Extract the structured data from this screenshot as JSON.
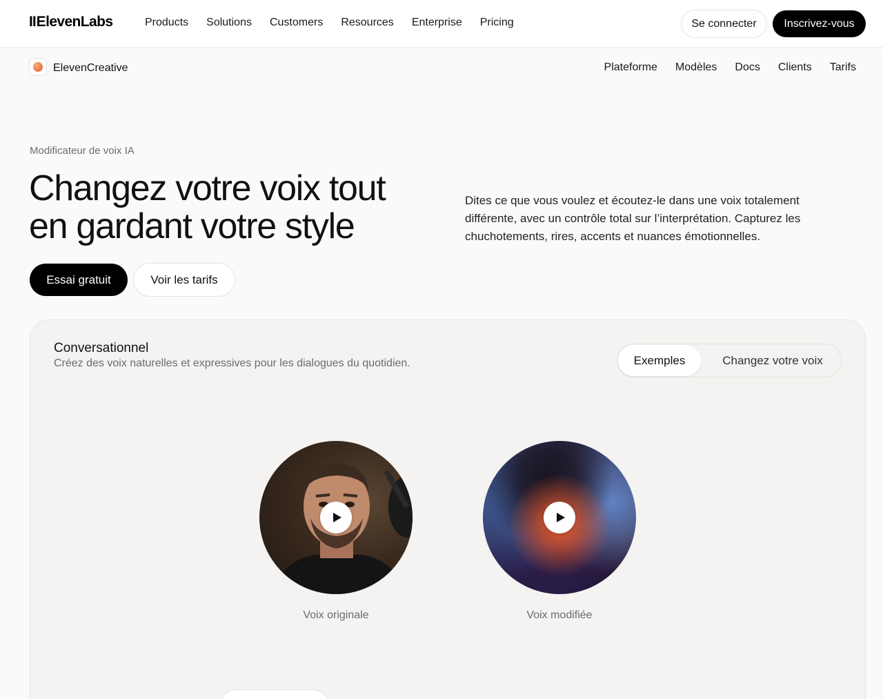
{
  "topnav": {
    "brand_bars": "II",
    "brand_name": "ElevenLabs",
    "menu": [
      "Products",
      "Solutions",
      "Customers",
      "Resources",
      "Enterprise",
      "Pricing"
    ],
    "login_label": "Se connecter",
    "signup_label": "Inscrivez-vous"
  },
  "subnav": {
    "product_name": "ElevenCreative",
    "menu": [
      "Plateforme",
      "Modèles",
      "Docs",
      "Clients",
      "Tarifs"
    ]
  },
  "hero": {
    "eyebrow": "Modificateur de voix IA",
    "title_line1": "Changez votre voix tout",
    "title_line2": "en gardant votre style",
    "description": "Dites ce que vous voulez et écoutez-le dans une voix totalement différente, avec un contrôle total sur l’interprétation. Capturez les chuchotements, rires, accents et nuances émotionnelles.",
    "cta_primary": "Essai gratuit",
    "cta_secondary": "Voir les tarifs"
  },
  "demo": {
    "title": "Conversationnel",
    "subtitle": "Créez des voix naturelles et expressives pour les dialogues du quotidien.",
    "tabs": [
      "Exemples",
      "Changez votre voix"
    ],
    "active_tab": "Exemples",
    "samples": [
      {
        "label": "Voix originale",
        "icon": "play-icon"
      },
      {
        "label": "Voix modifiée",
        "icon": "play-icon"
      }
    ]
  },
  "colors": {
    "primary_button": "#000000",
    "page_background": "#fafafa",
    "card_background": "#f4f3f1",
    "muted_text": "#6b6b6b"
  }
}
